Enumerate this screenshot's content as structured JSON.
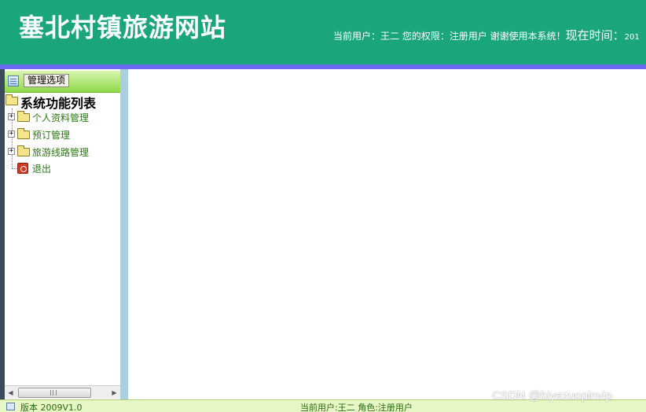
{
  "header": {
    "title": "塞北村镇旅游网站",
    "info_text": "当前用户：王二 您的权限：注册用户 谢谢使用本系统！",
    "time_label": "现在时间：",
    "time_value": "201"
  },
  "sidebar": {
    "panel_button": "管理选项",
    "tree_root": "系统功能列表",
    "items": [
      {
        "label": "个人资料管理",
        "icon": "folder-icon",
        "expander": "+"
      },
      {
        "label": "预订管理",
        "icon": "folder-icon",
        "expander": "+"
      },
      {
        "label": "旅游线路管理",
        "icon": "folder-icon",
        "expander": "+"
      },
      {
        "label": "退出",
        "icon": "exit-icon"
      }
    ],
    "scroll": {
      "left_arrow": "◀",
      "right_arrow": "▶"
    }
  },
  "footer": {
    "version": "版本 2009V1.0",
    "user_role": "当前用户:王二  角色:注册用户"
  },
  "watermark": "CSDN @biyezuopinvip",
  "colors": {
    "header_bg": "#1aa57b",
    "header_stripe": "#6a6af0",
    "panel_divider": "#a9cfe0",
    "footer_bg": "#e6f6c4",
    "tree_text": "#2a7a12"
  }
}
